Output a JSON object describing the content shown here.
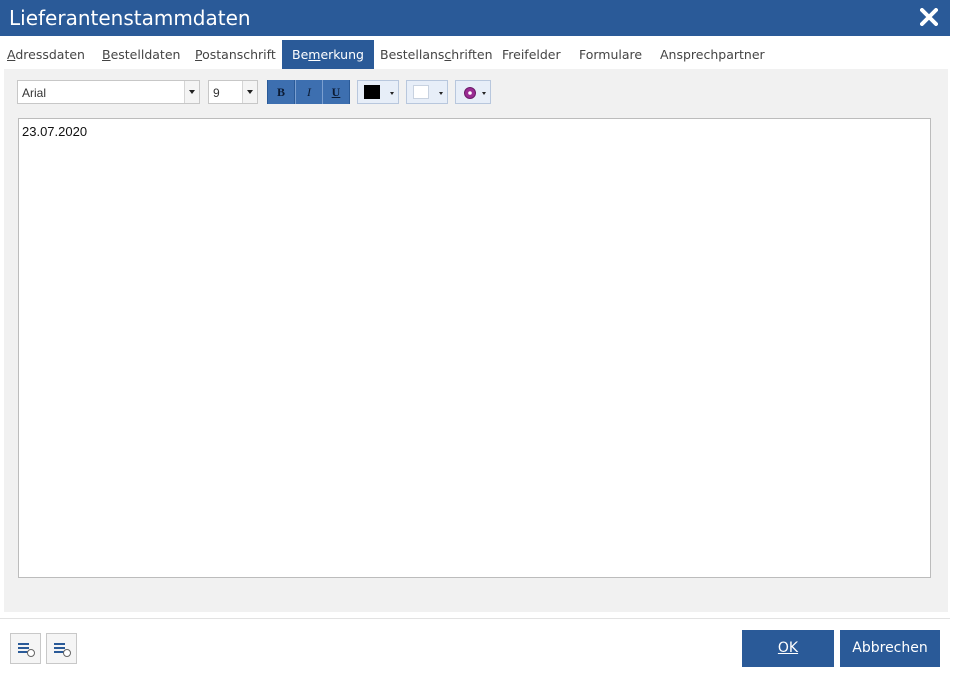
{
  "window": {
    "title": "Lieferantenstammdaten",
    "close_icon": "close-icon"
  },
  "tabs": [
    {
      "label": "Adressdaten",
      "underline_index": 0,
      "active": false
    },
    {
      "label": "Bestelldaten",
      "underline_index": 0,
      "active": false
    },
    {
      "label": "Postanschrift",
      "underline_index": 0,
      "active": false
    },
    {
      "label": "Bemerkung",
      "underline_index": 2,
      "active": true
    },
    {
      "label": "Bestellanschriften",
      "underline_index": 10,
      "active": false
    },
    {
      "label": "Freifelder",
      "underline_index": -1,
      "active": false
    },
    {
      "label": "Formulare",
      "underline_index": -1,
      "active": false
    },
    {
      "label": "Ansprechpartner",
      "underline_index": -1,
      "active": false
    }
  ],
  "toolbar": {
    "font": "Arial",
    "size": "9",
    "bold_label": "B",
    "italic_label": "I",
    "underline_label": "U",
    "text_color": "#000000",
    "background_color": "#ffffff",
    "special_icon": "color-wheel-icon",
    "accent": "#2a5a98"
  },
  "editor": {
    "content": "23.07.2020"
  },
  "footer": {
    "left_buttons": [
      {
        "icon": "list-options-icon"
      },
      {
        "icon": "list-settings-icon"
      }
    ],
    "ok_label": "OK",
    "cancel_label": "Abbrechen"
  }
}
